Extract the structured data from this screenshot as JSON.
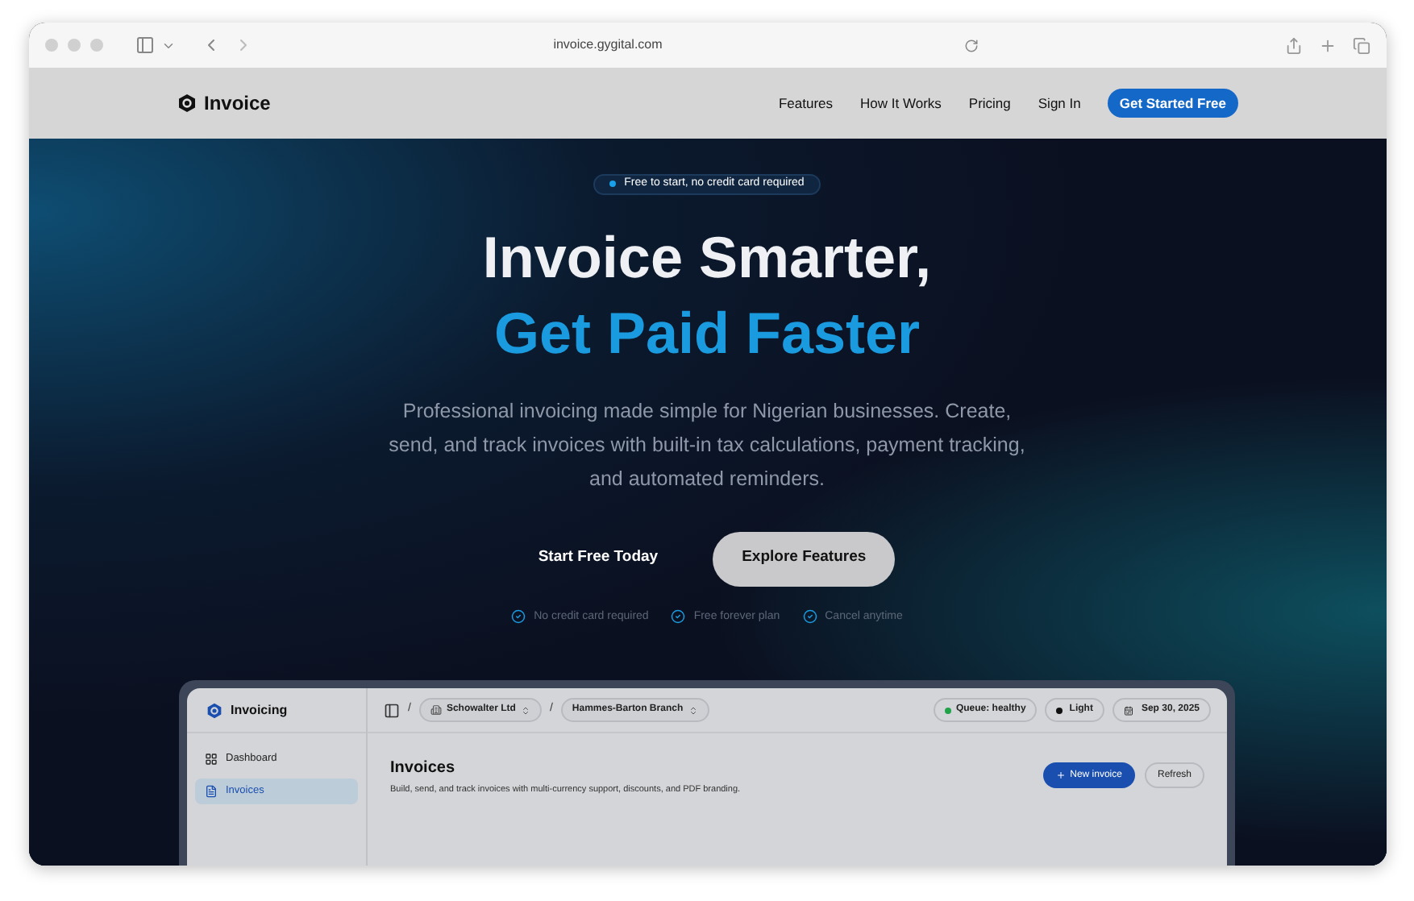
{
  "browser": {
    "url": "invoice.gygital.com"
  },
  "nav": {
    "brand": "Invoice",
    "links": [
      {
        "label": "Features"
      },
      {
        "label": "How It Works"
      },
      {
        "label": "Pricing"
      },
      {
        "label": "Sign In"
      }
    ],
    "cta": "Get Started Free"
  },
  "hero": {
    "badge": "Free to start, no credit card required",
    "title_line1": "Invoice Smarter,",
    "title_line2": "Get Paid Faster",
    "description": "Professional invoicing made simple for Nigerian businesses. Create, send, and track invoices with built-in tax calculations, payment tracking, and automated reminders.",
    "primary_button": "Start Free Today",
    "secondary_button": "Explore Features",
    "perks": [
      "No credit card required",
      "Free forever plan",
      "Cancel anytime"
    ]
  },
  "preview": {
    "app_name": "Invoicing",
    "sidebar_items": [
      {
        "label": "Dashboard",
        "kind": "grid",
        "selected": false
      },
      {
        "label": "Invoices",
        "kind": "doc",
        "selected": true
      }
    ],
    "breadcrumbs": [
      {
        "separator": "/",
        "label": "Schowalter Ltd"
      },
      {
        "separator": "/",
        "label": "Hammes-Barton Branch"
      }
    ],
    "status": {
      "queue": "Queue: healthy",
      "theme": "Light",
      "date": "Sep 30, 2025"
    },
    "page_title": "Invoices",
    "page_subtitle": "Build, send, and track invoices with multi-currency support, discounts, and PDF branding.",
    "new_button": "New invoice",
    "refresh_button": "Refresh"
  }
}
